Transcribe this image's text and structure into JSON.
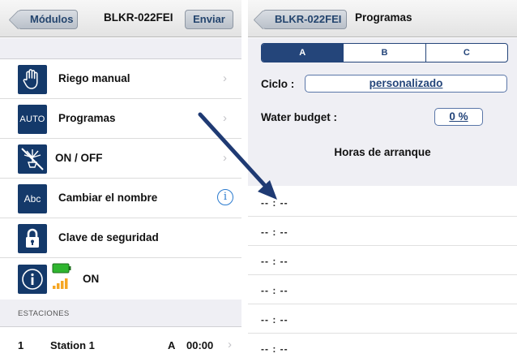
{
  "left": {
    "back_label": "Módulos",
    "title": "BLKR-022FEI",
    "send_label": "Enviar",
    "menu": [
      {
        "label": "Riego manual",
        "icon": "hand-icon"
      },
      {
        "label": "Programas",
        "icon": "auto-icon",
        "tile_text": "AUTO"
      },
      {
        "label": "ON / OFF",
        "icon": "sprinkler-off-icon"
      },
      {
        "label": "Cambiar el nombre",
        "icon": "abc-icon",
        "tile_text": "Abc"
      },
      {
        "label": "Clave de seguridad",
        "icon": "padlock-icon"
      },
      {
        "label": "ON",
        "icon": "info-icon"
      }
    ],
    "section_title": "ESTACIONES",
    "station": {
      "number": "1",
      "name": "Station 1",
      "program": "A",
      "time": "00:00"
    }
  },
  "right": {
    "back_label": "BLKR-022FEI",
    "title": "Programas",
    "tabs": [
      {
        "label": "A",
        "active": true
      },
      {
        "label": "B",
        "active": false
      },
      {
        "label": "C",
        "active": false
      }
    ],
    "ciclo_label": "Ciclo :",
    "ciclo_value": "personalizado",
    "water_budget_label": "Water budget :",
    "water_budget_value": "0 %",
    "start_times_title": "Horas de arranque",
    "start_times": [
      "-- : --",
      "-- : --",
      "-- : --",
      "-- : --",
      "-- : --",
      "-- : --"
    ]
  },
  "colors": {
    "accent": "#24457a",
    "tile": "#14396a",
    "arrow": "#1f3a73",
    "battery": "#2fb52f",
    "signal": "#f5a623"
  }
}
